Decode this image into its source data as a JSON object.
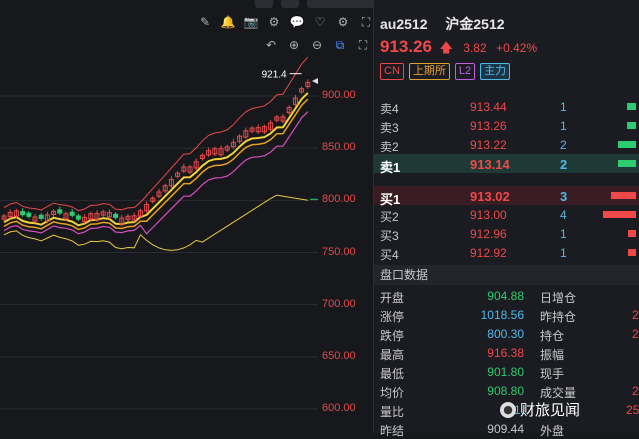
{
  "toolbar_top": [
    "pencil-icon",
    "bell-icon",
    "camera-icon",
    "settings-icon",
    "chat-icon",
    "heart-icon",
    "settings2-icon",
    "expand-icon"
  ],
  "toolbar_second": [
    "undo-icon",
    "zoom-in-icon",
    "zoom-out-icon",
    "select-icon",
    "fullscreen-icon"
  ],
  "chart": {
    "y_ticks": [
      "900.00",
      "850.00",
      "800.00",
      "750.00",
      "700.00",
      "650.00",
      "600.00"
    ],
    "high_marker": "921.4",
    "colors": {
      "up": "#e84a4a",
      "down": "#2ecc71",
      "ma1": "#f3d23a",
      "ma2": "#e8a020",
      "ma3": "#d84cc0",
      "band": "#e84a4a",
      "lower": "#e9c840"
    }
  },
  "symbol": {
    "code": "au2512",
    "name": "沪金2512"
  },
  "quote": {
    "price": "913.26",
    "arrow": "🡅",
    "change": "3.82",
    "pct": "+0.42%"
  },
  "tags": [
    "CN",
    "上期所",
    "L2",
    "主力"
  ],
  "sell": [
    {
      "label": "卖4",
      "price": "913.44",
      "vol": "1"
    },
    {
      "label": "卖3",
      "price": "913.26",
      "vol": "1"
    },
    {
      "label": "卖2",
      "price": "913.22",
      "vol": "2"
    },
    {
      "label": "卖1",
      "price": "913.14",
      "vol": "2"
    }
  ],
  "buy": [
    {
      "label": "买1",
      "price": "913.02",
      "vol": "3"
    },
    {
      "label": "买2",
      "price": "913.00",
      "vol": "4"
    },
    {
      "label": "买3",
      "price": "912.96",
      "vol": "1"
    },
    {
      "label": "买4",
      "price": "912.92",
      "vol": "1"
    }
  ],
  "section_title": "盘口数据",
  "stats": [
    {
      "l1": "开盘",
      "v1": "904.88",
      "c1": "#2ecc71",
      "l2": "日增仓",
      "v2": ""
    },
    {
      "l1": "涨停",
      "v1": "1018.56",
      "c1": "#4fb9e8",
      "l2": "昨持仓",
      "v2": "2"
    },
    {
      "l1": "跌停",
      "v1": "800.30",
      "c1": "#4fb9e8",
      "l2": "持仓",
      "v2": "2"
    },
    {
      "l1": "最高",
      "v1": "916.38",
      "c1": "#f04848",
      "l2": "振幅",
      "v2": ""
    },
    {
      "l1": "最低",
      "v1": "901.80",
      "c1": "#2ecc71",
      "l2": "现手",
      "v2": ""
    },
    {
      "l1": "均价",
      "v1": "908.80",
      "c1": "#2ecc71",
      "l2": "成交量",
      "v2": "2"
    },
    {
      "l1": "量比",
      "v1": "1.",
      "c1": "#4fb9e8",
      "l2": "",
      "v2": "25"
    },
    {
      "l1": "昨结",
      "v1": "909.44",
      "c1": "#c8c9cc",
      "l2": "外盘",
      "v2": ""
    }
  ],
  "watermark": "财旅见闻"
}
